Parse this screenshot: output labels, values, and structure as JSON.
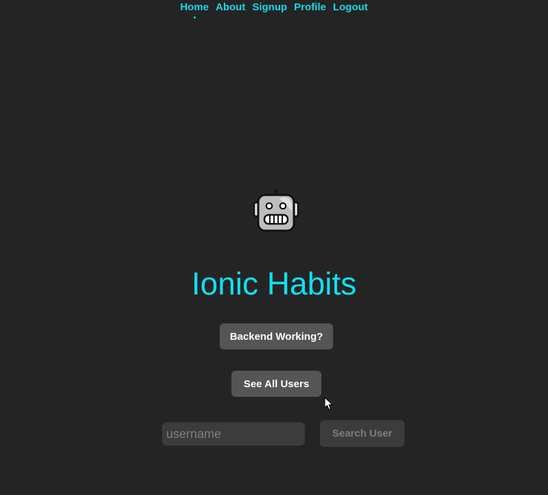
{
  "nav": {
    "items": [
      {
        "label": "Home",
        "active": true
      },
      {
        "label": "About"
      },
      {
        "label": "Signup"
      },
      {
        "label": "Profile"
      },
      {
        "label": "Logout"
      }
    ]
  },
  "hero": {
    "icon": "robot-icon",
    "title": "Ionic Habits"
  },
  "actions": {
    "backend_label": "Backend Working?",
    "all_users_label": "See All Users"
  },
  "search": {
    "placeholder": "username",
    "value": "",
    "button_label": "Search User"
  },
  "colors": {
    "background": "#242424",
    "accent": "#17d9e6",
    "button": "#555555",
    "disabled": "#3c3c3c"
  }
}
